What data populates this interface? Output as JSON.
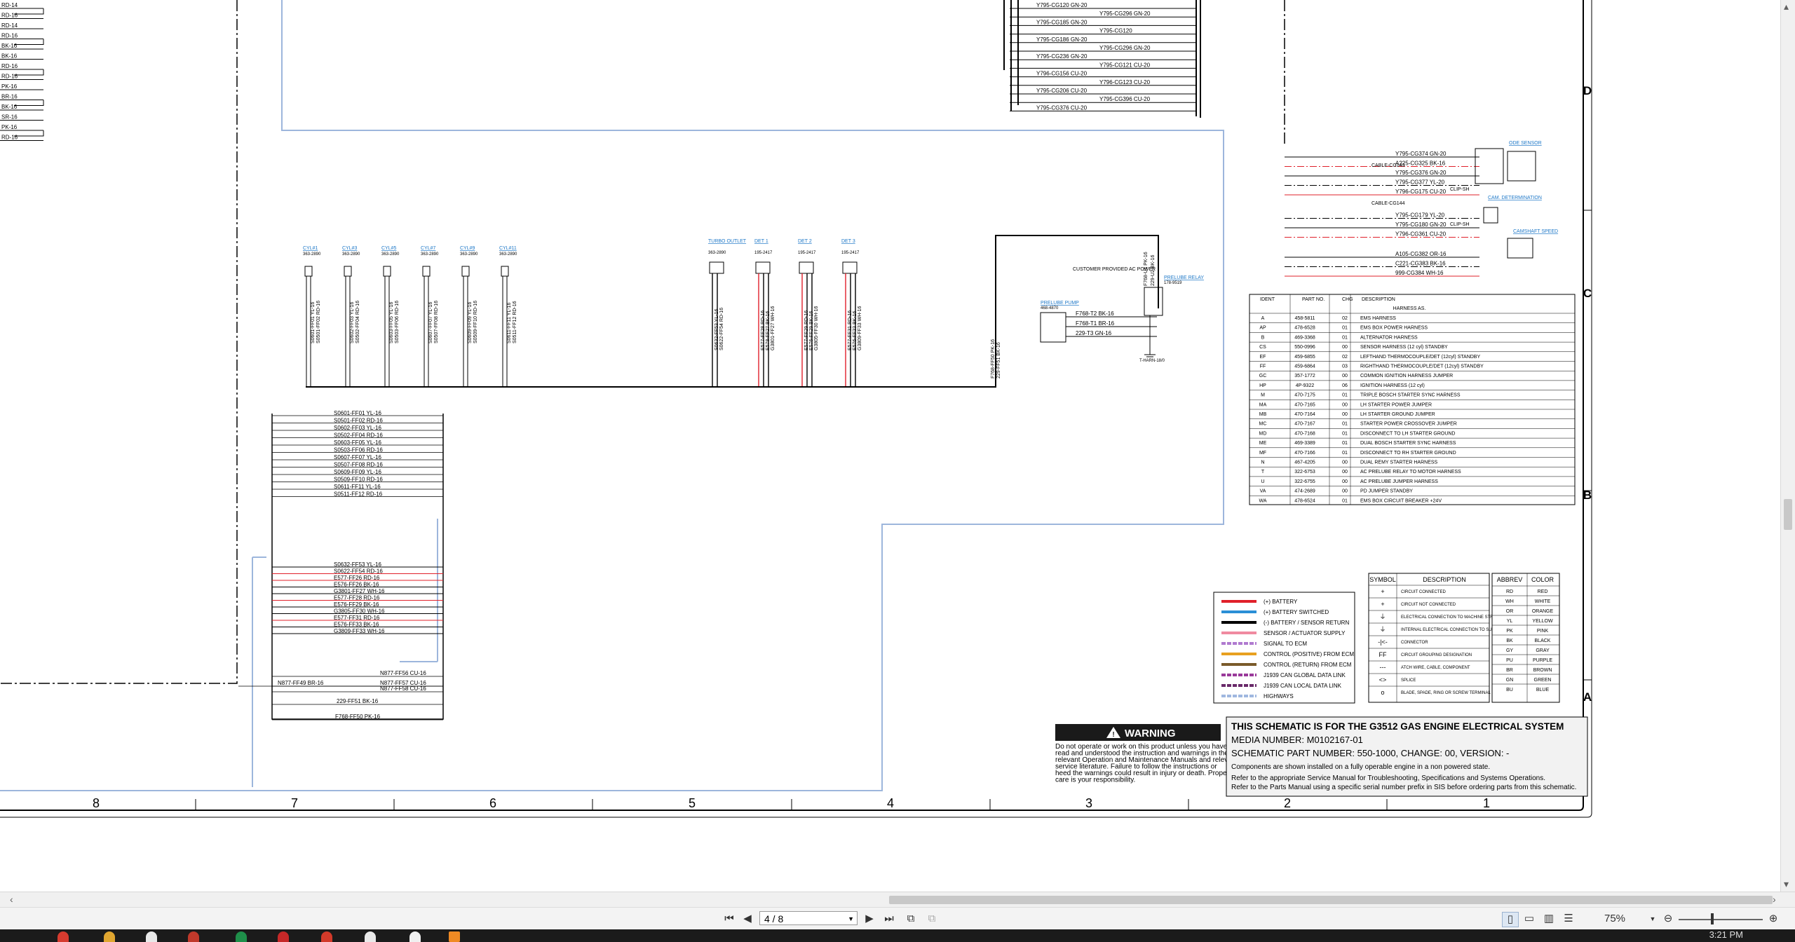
{
  "viewer": {
    "page_indicator": "4 / 8",
    "zoom": "75%",
    "clock": "3:21 PM"
  },
  "frame": {
    "columns": [
      "8",
      "7",
      "6",
      "5",
      "4",
      "3",
      "2",
      "1"
    ],
    "rows": [
      "D",
      "C",
      "B",
      "A"
    ]
  },
  "left_edge_labels": [
    "RD-14",
    "RD-16",
    "RD-14",
    "RD-16",
    "BK-16",
    "BK-16",
    "RD-16",
    "RD-16",
    "PK-16",
    "BR-16",
    "BK-16",
    "SR-16",
    "PK-16",
    "RD-16"
  ],
  "top_connectors": [
    "Y795-CG120 GN-20",
    "Y795-CG296 GN-20",
    "Y795-CG185 GN-20",
    "Y795-CG120",
    "Y795-CG186 GN-20",
    "Y795-CG296 GN-20",
    "Y795-CG236 GN-20",
    "Y795-CG121 CU-20",
    "Y796-CG156 CU-20",
    "Y796-CG123 CU-20",
    "Y795-CG206 CU-20",
    "Y795-CG396 CU-20",
    "Y795-CG376 CU-20"
  ],
  "sensor_block": {
    "lines": [
      "Y795-CG374 GN-20",
      "A225-CG325 BK-16",
      "Y795-CG376 GN-20",
      "Y795-CG377 YL-20",
      "Y796-CG175 CU-20",
      "Y795-CG179 YL-20",
      "Y795-CG180 GN-20",
      "Y796-CG361 CU-20",
      "A105-CG382 OR-16",
      "C221-CG383 BK-16",
      "999-CG384 WH-16"
    ],
    "labels": [
      "CABLE-CG143",
      "CABLE-CG144",
      "CLIP-SH",
      "CLIP-SH",
      "ODE SENSOR",
      "CAM. DETERMINATION",
      "CAMSHAFT SPEED"
    ]
  },
  "cylinders": [
    {
      "title": "CYL#1",
      "pn": "363-2890",
      "wires": [
        "S0601-FF01 YL-16",
        "S0501-FF02 RD-16"
      ]
    },
    {
      "title": "CYL#3",
      "pn": "363-2890",
      "wires": [
        "S0602-FF03 YL-16",
        "S0502-FF04 RD-16"
      ]
    },
    {
      "title": "CYL#5",
      "pn": "363-2890",
      "wires": [
        "S0603-FF05 YL-16",
        "S0503-FF06 RD-16"
      ]
    },
    {
      "title": "CYL#7",
      "pn": "363-2890",
      "wires": [
        "S0607-FF07 YL-16",
        "S0507-FF08 RD-16"
      ]
    },
    {
      "title": "CYL#9",
      "pn": "363-2890",
      "wires": [
        "S0609-FF09 YL-16",
        "S0509-FF10 RD-16"
      ]
    },
    {
      "title": "CYL#11",
      "pn": "363-2890",
      "wires": [
        "S0611-FF11 YL-16",
        "S0511-FF12 RD-16"
      ]
    }
  ],
  "mid_devices": [
    {
      "title": "TURBO OUTLET",
      "pn": "363-2890",
      "wires": [
        "S0632-FF53 YL-16",
        "S0622-FF54 RD-16"
      ]
    },
    {
      "title": "DET 1",
      "pn": "195-2417",
      "wires": [
        "E577-FF28 RD-16",
        "E578-FF27 BK-16",
        "G3801-FF27 WH-16"
      ]
    },
    {
      "title": "DET 2",
      "pn": "195-2417",
      "wires": [
        "E577-FF29 RD-16",
        "E576-FF29 BK-16",
        "G3805-FF30 WH-16"
      ]
    },
    {
      "title": "DET 3",
      "pn": "195-2417",
      "wires": [
        "E577-FF31 RD-16",
        "E576-FF33 BK-16",
        "G3809-FF33 WH-16"
      ]
    }
  ],
  "prelube": {
    "customer": "CUSTOMER PROVIDED AC POWER",
    "pump": "PRELUBE PUMP",
    "pump_pn": "468-4870",
    "relay": "PRELUBE RELAY",
    "relay_pn": "178-9519",
    "ground": "T-HARN-18/0",
    "wires": [
      "F768-T2 BK-16",
      "F768-T1 BR-16",
      "229-T3 GN-16",
      "F768-U1 PK-16",
      "229-U2 BK-16",
      "F768-FF50 PK-16",
      "229-FF51 BK-16"
    ]
  },
  "left_bundle": {
    "rows": [
      "S0601-FF01 YL-16",
      "S0501-FF02 RD-16",
      "S0602-FF03 YL-16",
      "S0502-FF04 RD-16",
      "S0603-FF05 YL-16",
      "S0503-FF06 RD-16",
      "S0607-FF07 YL-16",
      "S0507-FF08 RD-16",
      "S0609-FF09 YL-16",
      "S0509-FF10 RD-16",
      "S0611-FF11 YL-16",
      "S0511-FF12 RD-16"
    ],
    "rows2": [
      "S0632-FF53 YL-16",
      "S0622-FF54 RD-16",
      "E577-FF26 RD-16",
      "E576-FF26 BK-16",
      "G3801-FF27 WH-16",
      "E577-FF28 RD-16",
      "E576-FF29 BK-16",
      "G3805-FF30 WH-16",
      "E577-FF31 RD-16",
      "E576-FF33 BK-16",
      "G3809-FF33 WH-16"
    ],
    "bottom": [
      "N877-FF49 BR-16",
      "N877-FF56 CU-16",
      "N877-FF57 CU-16",
      "N877-FF58 CU-16",
      "229-FF51 BK-16",
      "F768-FF50 PK-16"
    ]
  },
  "harness_table": {
    "headers": [
      "IDENT",
      "PART NO.",
      "CHG",
      "DESCRIPTION"
    ],
    "title": "HARNESS AS.",
    "rows": [
      [
        "A",
        "458-5811",
        "02",
        "EMS HARNESS"
      ],
      [
        "AP",
        "478-6528",
        "01",
        "EMS BOX POWER HARNESS"
      ],
      [
        "B",
        "469-3368",
        "01",
        "ALTERNATOR HARNESS"
      ],
      [
        "CS",
        "550-0996",
        "00",
        "SENSOR HARNESS (12 cyl) STANDBY"
      ],
      [
        "EF",
        "459-6855",
        "02",
        "LEFTHAND THERMOCOUPLE/DET (12cyl) STANDBY"
      ],
      [
        "FF",
        "459-6864",
        "03",
        "RIGHTHAND THERMOCOUPLE/DET (12cyl) STANDBY"
      ],
      [
        "GC",
        "357-1772",
        "00",
        "COMMON IGNITION HARNESS JUMPER"
      ],
      [
        "HP",
        "4P-9322",
        "06",
        "IGNITION HARNESS (12 cyl)"
      ],
      [
        "M",
        "470-7175",
        "01",
        "TRIPLE BOSCH STARTER SYNC HARNESS"
      ],
      [
        "MA",
        "470-7165",
        "00",
        "LH STARTER POWER JUMPER"
      ],
      [
        "MB",
        "470-7164",
        "00",
        "LH STARTER GROUND JUMPER"
      ],
      [
        "MC",
        "470-7167",
        "01",
        "STARTER POWER CROSSOVER JUMPER"
      ],
      [
        "MD",
        "470-7168",
        "01",
        "DISCONNECT TO LH STARTER GROUND"
      ],
      [
        "ME",
        "469-3389",
        "01",
        "DUAL BOSCH STARTER SYNC HARNESS"
      ],
      [
        "MF",
        "470-7166",
        "01",
        "DISCONNECT TO RH STARTER GROUND"
      ],
      [
        "N",
        "467-4205",
        "00",
        "DUAL REMY STARTER HARNESS"
      ],
      [
        "T",
        "322-6753",
        "00",
        "AC PRELUBE RELAY TO MOTOR HARNESS"
      ],
      [
        "U",
        "322-6755",
        "00",
        "AC PRELUBE JUMPER HARNESS"
      ],
      [
        "VA",
        "474-2689",
        "00",
        "PD JUMPER STANDBY"
      ],
      [
        "WA",
        "478-6524",
        "01",
        "EMS BOX CIRCUIT BREAKER +24V"
      ]
    ]
  },
  "line_legend": [
    {
      "label": "(+) BATTERY",
      "color": "#e0202a"
    },
    {
      "label": "(+) BATTERY SWITCHED",
      "color": "#2a8fd6"
    },
    {
      "label": "(-) BATTERY / SENSOR RETURN",
      "color": "#000000"
    },
    {
      "label": "SENSOR / ACTUATOR SUPPLY",
      "color": "#f08aa0"
    },
    {
      "label": "SIGNAL TO ECM",
      "color": "#b07ad0"
    },
    {
      "label": "CONTROL (POSITIVE) FROM ECM",
      "color": "#e8a020"
    },
    {
      "label": "CONTROL (RETURN) FROM ECM",
      "color": "#7a5a2a"
    },
    {
      "label": "J1939 CAN GLOBAL DATA LINK",
      "color": "#9a3a9a"
    },
    {
      "label": "J1939 CAN LOCAL DATA LINK",
      "color": "#6a2a6a"
    },
    {
      "label": "HIGHWAYS",
      "color": "#a0b8e0"
    }
  ],
  "symbol_table": {
    "headers": [
      "SYMBOL",
      "DESCRIPTION"
    ],
    "rows": [
      [
        "+",
        "CIRCUIT CONNECTED"
      ],
      [
        "+",
        "CIRCUIT NOT CONNECTED"
      ],
      [
        "⏚",
        "ELECTRICAL CONNECTION TO MACHINE STRUCTURE"
      ],
      [
        "⏚",
        "INTERNAL ELECTRICAL CONNECTION TO SURFACE OF COMPONENT"
      ],
      [
        "-|<-",
        "CONNECTOR"
      ],
      [
        "FF",
        "CIRCUIT GROUPING DESIGNATION"
      ],
      [
        "---",
        "ATCH WIRE, CABLE, COMPONENT"
      ],
      [
        "<>",
        "SPLICE"
      ],
      [
        "o",
        "BLADE, SPADE, RING OR SCREW TERMINAL"
      ]
    ]
  },
  "color_table": {
    "headers": [
      "ABBREV",
      "COLOR"
    ],
    "rows": [
      [
        "RD",
        "RED"
      ],
      [
        "WH",
        "WHITE"
      ],
      [
        "OR",
        "ORANGE"
      ],
      [
        "YL",
        "YELLOW"
      ],
      [
        "PK",
        "PINK"
      ],
      [
        "BK",
        "BLACK"
      ],
      [
        "GY",
        "GRAY"
      ],
      [
        "PU",
        "PURPLE"
      ],
      [
        "BR",
        "BROWN"
      ],
      [
        "GN",
        "GREEN"
      ],
      [
        "BU",
        "BLUE"
      ]
    ]
  },
  "warning": {
    "title": "WARNING",
    "text": "Do not operate or work on this product unless you have read and understood the instruction and warnings in the relevant Operation and Maintenance Manuals and relevant service literature. Failure to follow the instructions or heed the warnings could result in injury or death. Proper care is your responsibility."
  },
  "title_block": {
    "heading": "THIS SCHEMATIC IS FOR THE G3512 GAS ENGINE ELECTRICAL SYSTEM",
    "media": "MEDIA NUMBER: M0102167-01",
    "part": "SCHEMATIC PART NUMBER: 550-1000, CHANGE: 00, VERSION: -",
    "note1": "Components are shown installed on a fully operable engine in a non powered state.",
    "note2": "Refer to the appropriate Service Manual for Troubleshooting, Specifications and Systems Operations.",
    "note3": "Refer to the Parts Manual using a specific serial number prefix in SIS before ordering parts from this schematic."
  }
}
